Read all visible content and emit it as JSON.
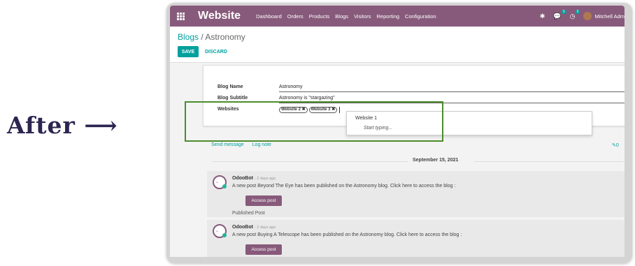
{
  "caption": {
    "text": "After ⟶"
  },
  "topbar": {
    "brand": "Website",
    "menu": [
      "Dashboard",
      "Orders",
      "Products",
      "Blogs",
      "Visitors",
      "Reporting",
      "Configuration"
    ],
    "messages_badge": "5",
    "activity_badge": "5",
    "user_name": "Mitchell Adm"
  },
  "breadcrumb": {
    "parent": "Blogs",
    "separator": "/",
    "current": "Astronomy"
  },
  "buttons": {
    "save": "SAVE",
    "discard": "DISCARD"
  },
  "form": {
    "blog_name_label": "Blog Name",
    "blog_name_value": "Astronomy",
    "blog_subtitle_label": "Blog Subtitle",
    "blog_subtitle_value": "Astronomy is \"stargazing\"",
    "websites_label": "Websites",
    "website_tags": [
      "Website 2",
      "Website 3"
    ],
    "dropdown_option": "Website 1",
    "dropdown_hint": "Start typing..."
  },
  "chatter": {
    "send_message": "Send message",
    "log_note": "Log note",
    "attachments_count": "0",
    "date_separator": "September 15, 2021",
    "messages": [
      {
        "author": "OdooBot",
        "time": "- 2 days ago",
        "body": "A new post Beyond The Eye has been published on the Astronomy blog. Click here to access the blog :",
        "button": "Access post",
        "footer": "Published Post"
      },
      {
        "author": "OdooBot",
        "time": "- 2 days ago",
        "body": "A new post Buying A Telescope has been published on the Astronomy blog. Click here to access the blog :",
        "button": "Access post"
      }
    ]
  },
  "colors": {
    "brand_purple": "#875a7b",
    "teal": "#00a09d",
    "highlight_green": "#4c8c2c"
  }
}
